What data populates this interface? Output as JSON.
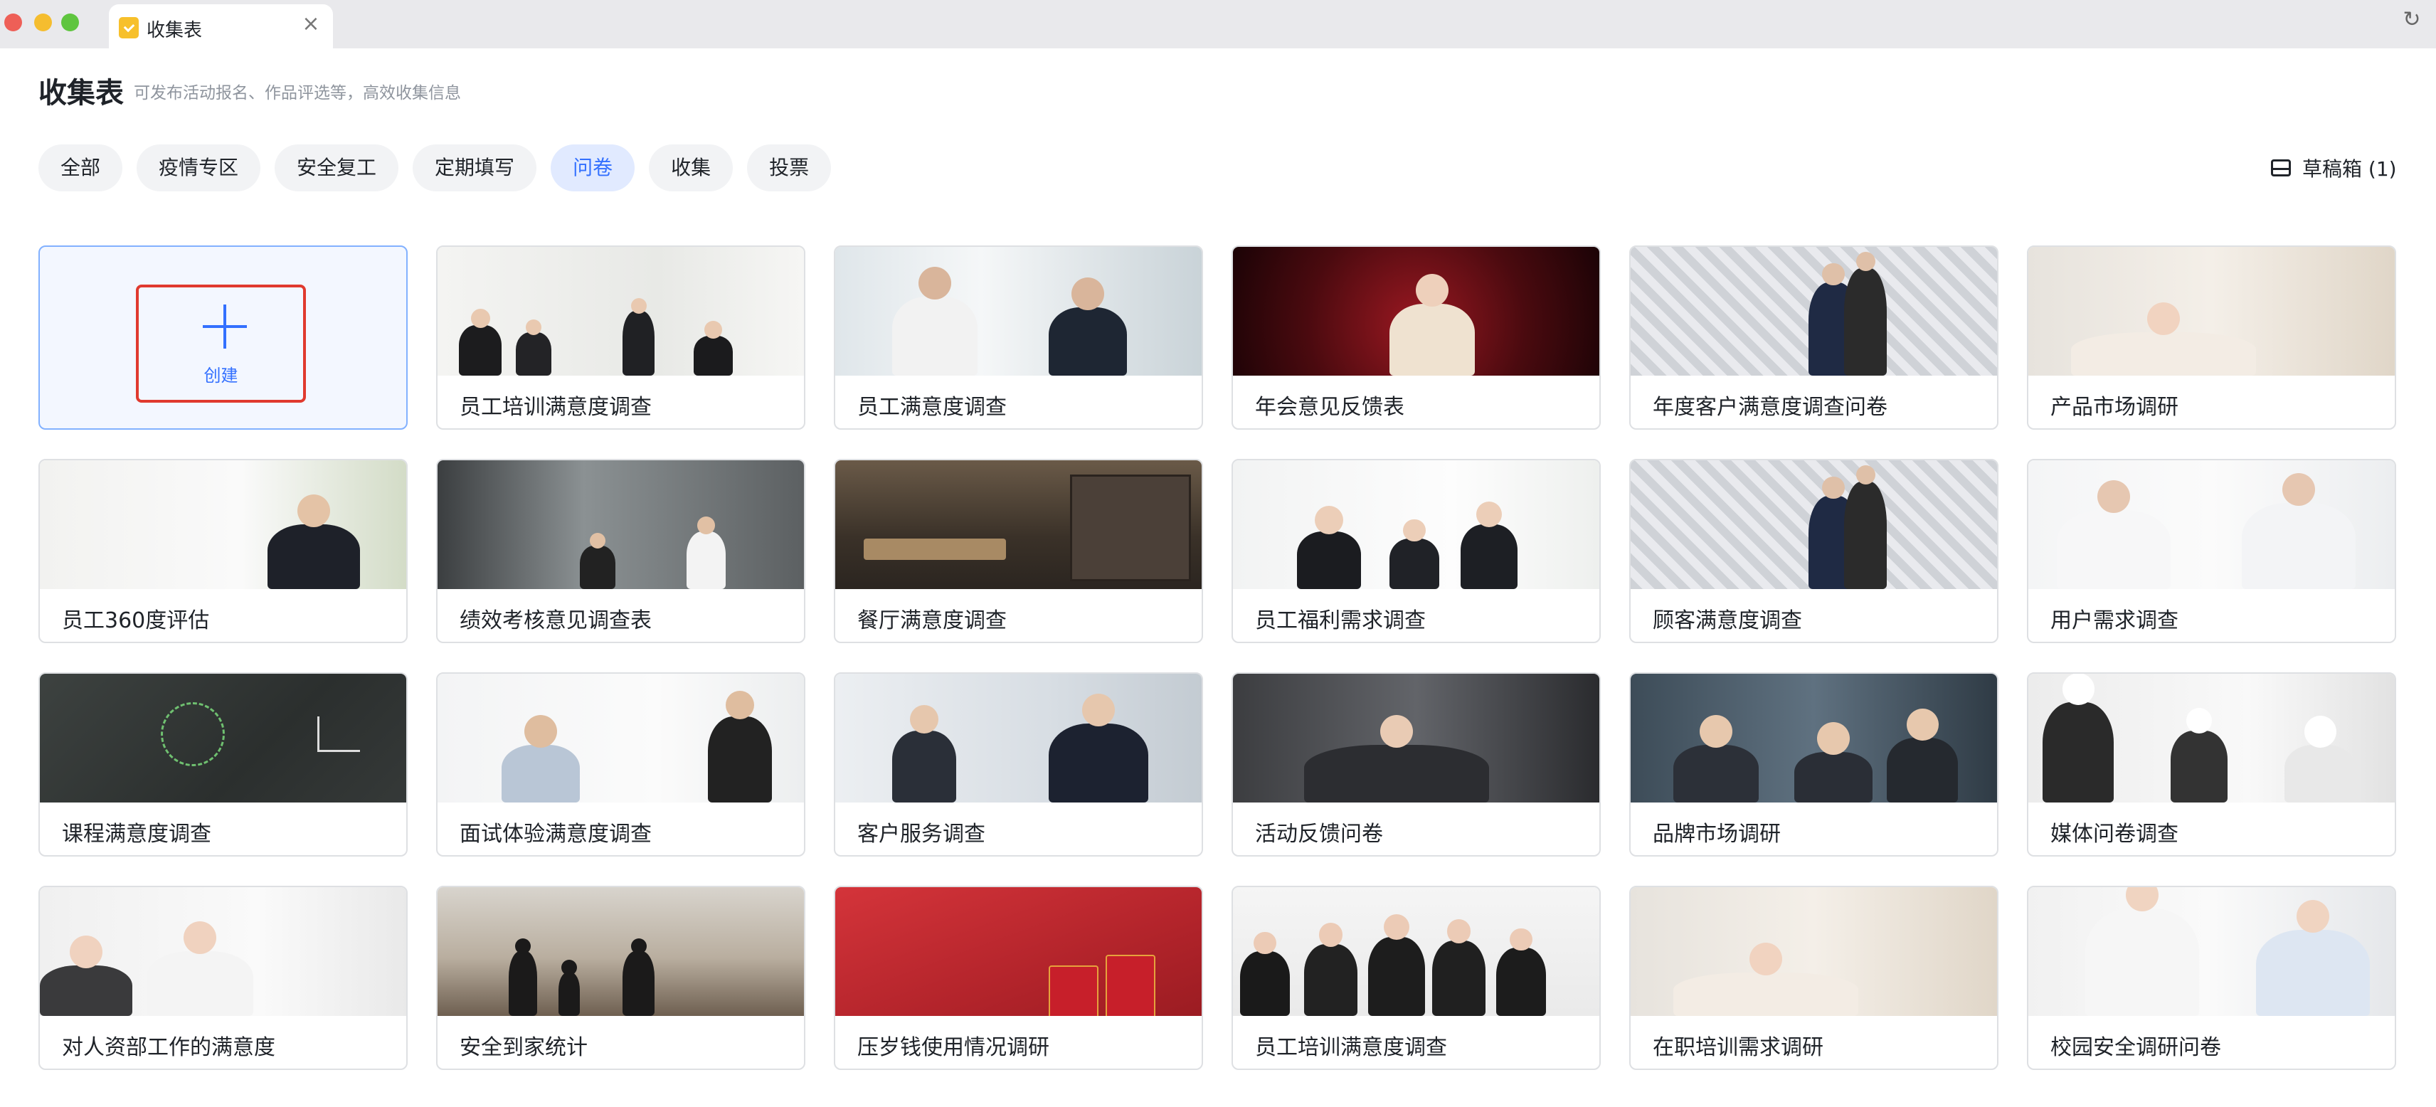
{
  "window": {
    "tab_title": "收集表",
    "tab_close_icon": "close-icon",
    "refresh_icon": "refresh-icon"
  },
  "header": {
    "title": "收集表",
    "subtitle": "可发布活动报名、作品评选等，高效收集信息"
  },
  "filters": [
    {
      "label": "全部",
      "active": false
    },
    {
      "label": "疫情专区",
      "active": false
    },
    {
      "label": "安全复工",
      "active": false
    },
    {
      "label": "定期填写",
      "active": false
    },
    {
      "label": "问卷",
      "active": true
    },
    {
      "label": "收集",
      "active": false
    },
    {
      "label": "投票",
      "active": false
    }
  ],
  "drafts": {
    "label": "草稿箱 (1)",
    "icon": "inbox-icon"
  },
  "create": {
    "label": "创建",
    "icon": "plus-icon"
  },
  "colors": {
    "accent": "#3370ff",
    "highlight_border": "#e03a2f",
    "card_border": "#dee0e3"
  },
  "templates": [
    {
      "title": "员工培训满意度调查",
      "scene": "office-meeting"
    },
    {
      "title": "员工满意度调查",
      "scene": "handshake"
    },
    {
      "title": "年会意见反馈表",
      "scene": "stage-red"
    },
    {
      "title": "年度客户满意度调查问卷",
      "scene": "shopping"
    },
    {
      "title": "产品市场调研",
      "scene": "writing"
    },
    {
      "title": "员工360度评估",
      "scene": "whiteboard"
    },
    {
      "title": "绩效考核意见调查表",
      "scene": "glass-office"
    },
    {
      "title": "餐厅满意度调查",
      "scene": "restaurant"
    },
    {
      "title": "员工福利需求调查",
      "scene": "team-laptop"
    },
    {
      "title": "顾客满意度调查",
      "scene": "shopping"
    },
    {
      "title": "用户需求调查",
      "scene": "doctors"
    },
    {
      "title": "课程满意度调查",
      "scene": "chalkboard"
    },
    {
      "title": "面试体验满意度调查",
      "scene": "interview"
    },
    {
      "title": "客户服务调查",
      "scene": "call-center"
    },
    {
      "title": "活动反馈问卷",
      "scene": "pen-writing"
    },
    {
      "title": "品牌市场调研",
      "scene": "business-team"
    },
    {
      "title": "媒体问卷调查",
      "scene": "microphones"
    },
    {
      "title": "对人资部工作的满意度",
      "scene": "smiling-woman"
    },
    {
      "title": "安全到家统计",
      "scene": "airport-sunset"
    },
    {
      "title": "压岁钱使用情况调研",
      "scene": "red-envelopes"
    },
    {
      "title": "员工培训满意度调查",
      "scene": "group-photo"
    },
    {
      "title": "在职培训需求调研",
      "scene": "writing"
    },
    {
      "title": "校园安全调研问卷",
      "scene": "documents"
    }
  ]
}
